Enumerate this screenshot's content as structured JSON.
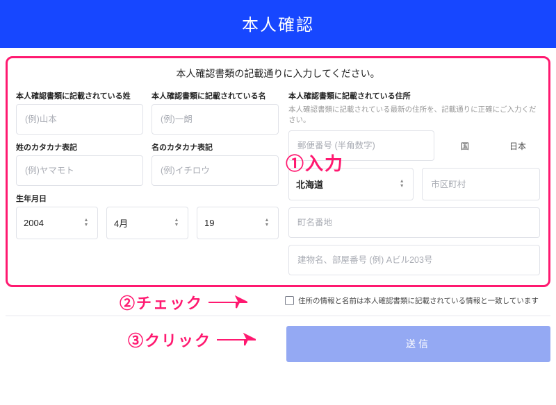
{
  "header": {
    "title": "本人確認"
  },
  "instruction": "本人確認書類の記載通りに入力してください。",
  "left": {
    "lastName": {
      "label": "本人確認書類に記載されている姓",
      "placeholder": "(例)山本"
    },
    "firstName": {
      "label": "本人確認書類に記載されている名",
      "placeholder": "(例)一朗"
    },
    "lastKana": {
      "label": "姓のカタカナ表記",
      "placeholder": "(例)ヤマモト"
    },
    "firstKana": {
      "label": "名のカタカナ表記",
      "placeholder": "(例)イチロウ"
    },
    "dob": {
      "label": "生年月日",
      "year": "2004",
      "month": "4月",
      "day": "19"
    }
  },
  "right": {
    "addressLabel": "本人確認書類に記載されている住所",
    "addressNote": "本人確認書類に記載されている最新の住所を、記載通りに正確にご入力ください。",
    "postalPlaceholder": "郵便番号 (半角数字)",
    "countryLabel": "国",
    "countryValue": "日本",
    "prefecture": "北海道",
    "cityPlaceholder": "市区町村",
    "streetPlaceholder": "町名番地",
    "buildingPlaceholder": "建物名、部屋番号 (例) Aビル203号"
  },
  "check": {
    "label": "住所の情報と名前は本人確認書類に記載されている情報と一致しています"
  },
  "submit": {
    "label": "送信"
  },
  "annotations": {
    "step1": "①入力",
    "step2": "②チェック",
    "step3": "③クリック"
  }
}
